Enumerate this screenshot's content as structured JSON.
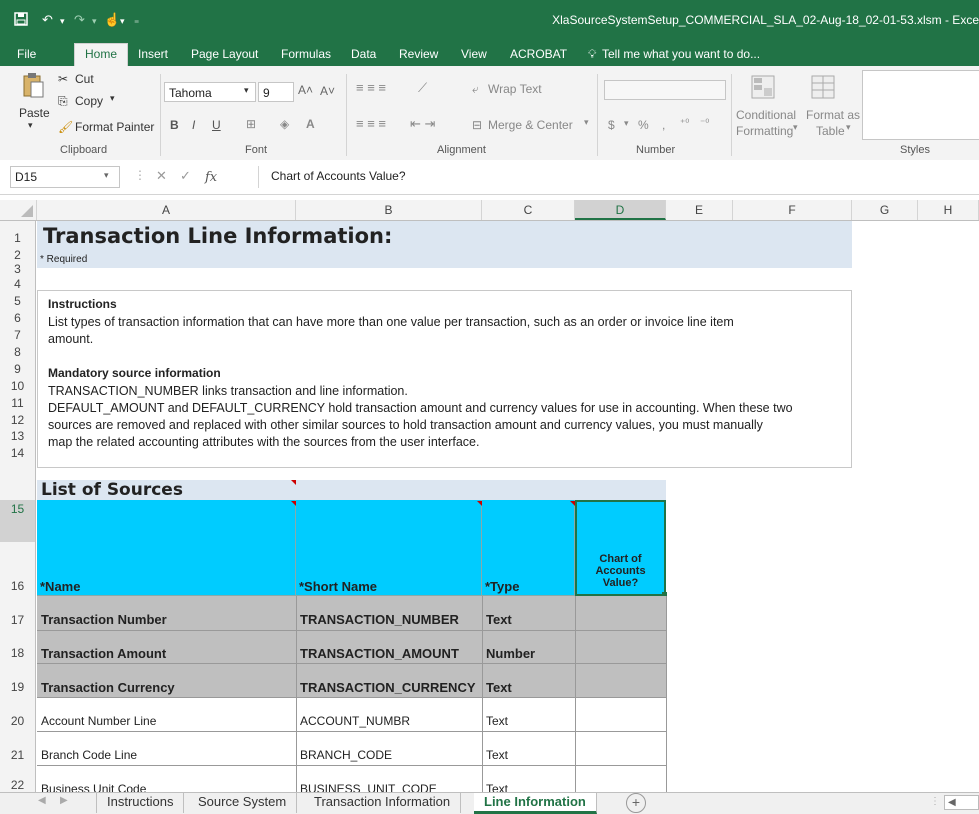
{
  "window": {
    "title": "XlaSourceSystemSetup_COMMERCIAL_SLA_02-Aug-18_02-01-53.xlsm - Exce",
    "quick_access": [
      "save-icon",
      "undo-icon",
      "redo-icon",
      "touch-mode-icon",
      "customize-icon"
    ]
  },
  "menu": {
    "tabs": [
      "File",
      "Home",
      "Insert",
      "Page Layout",
      "Formulas",
      "Data",
      "Review",
      "View",
      "ACROBAT"
    ],
    "active": "Home",
    "tell_me": "Tell me what you want to do..."
  },
  "ribbon": {
    "clipboard": {
      "paste": "Paste",
      "cut": "Cut",
      "copy": "Copy",
      "format_painter": "Format Painter",
      "group_label": "Clipboard"
    },
    "font": {
      "name": "Tahoma",
      "size": "9",
      "bold": "B",
      "italic": "I",
      "underline": "U",
      "group_label": "Font"
    },
    "alignment": {
      "wrap_text": "Wrap Text",
      "merge_center": "Merge & Center",
      "group_label": "Alignment"
    },
    "number": {
      "format_value": "",
      "currency": "$",
      "percent": "%",
      "comma": ",",
      "group_label": "Number"
    },
    "styles": {
      "conditional": "Conditional",
      "formatting": "Formatting",
      "format_as": "Format as",
      "table": "Table",
      "group_label": "Styles"
    }
  },
  "formula_bar": {
    "name_box": "D15",
    "fx": "fx",
    "value": "Chart of Accounts Value?"
  },
  "columns": [
    "A",
    "B",
    "C",
    "D",
    "E",
    "F",
    "G",
    "H"
  ],
  "selected_column": "D",
  "rows": [
    "1",
    "2",
    "3",
    "4",
    "5",
    "6",
    "7",
    "8",
    "9",
    "10",
    "11",
    "12",
    "13",
    "14",
    "15",
    "16",
    "17",
    "18",
    "19",
    "20",
    "21",
    "22"
  ],
  "selected_row": "15",
  "sheet": {
    "title": "Transaction Line Information:",
    "required_note": "* Required",
    "instructions": {
      "heading": "Instructions",
      "line1": "List types of transaction information that can have more than one value per transaction, such as an order or invoice line item",
      "line2": "amount.",
      "mandatory_heading": "Mandatory source information",
      "line3": "TRANSACTION_NUMBER links transaction and line information.",
      "line4": "DEFAULT_AMOUNT and  DEFAULT_CURRENCY hold transaction amount and currency values for use in accounting. When these two",
      "line5": "sources are removed and replaced with other similar sources to hold transaction amount and currency values, you must manually",
      "line6": "map the related accounting attributes with the sources from the user interface."
    },
    "list_title": "List of Sources",
    "table": {
      "headers": [
        "*Name",
        "*Short Name",
        "*Type",
        "Chart of\nAccounts\nValue?"
      ],
      "header_d_lines": [
        "Chart of",
        "Accounts",
        "Value?"
      ],
      "rows": [
        {
          "name": "Transaction Number",
          "short": "TRANSACTION_NUMBER",
          "type": "Text",
          "coa": ""
        },
        {
          "name": "Transaction Amount",
          "short": "TRANSACTION_AMOUNT",
          "type": "Number",
          "coa": ""
        },
        {
          "name": "Transaction Currency",
          "short": "TRANSACTION_CURRENCY",
          "type": "Text",
          "coa": ""
        },
        {
          "name": "Account Number Line",
          "short": "ACCOUNT_NUMBR",
          "type": "Text",
          "coa": ""
        },
        {
          "name": "Branch Code Line",
          "short": "BRANCH_CODE",
          "type": "Text",
          "coa": ""
        },
        {
          "name": "Business Unit Code",
          "short": "BUSINESS_UNIT_CODE",
          "type": "Text",
          "coa": ""
        }
      ]
    }
  },
  "sheet_tabs": {
    "tabs": [
      "Instructions",
      "Source System",
      "Transaction Information",
      "Line Information"
    ],
    "active": "Line Information"
  },
  "colors": {
    "excel_green": "#217346",
    "header_cyan": "#00ccff",
    "mandatory_gray": "#bfbfbf",
    "title_band": "#dce6f1"
  }
}
